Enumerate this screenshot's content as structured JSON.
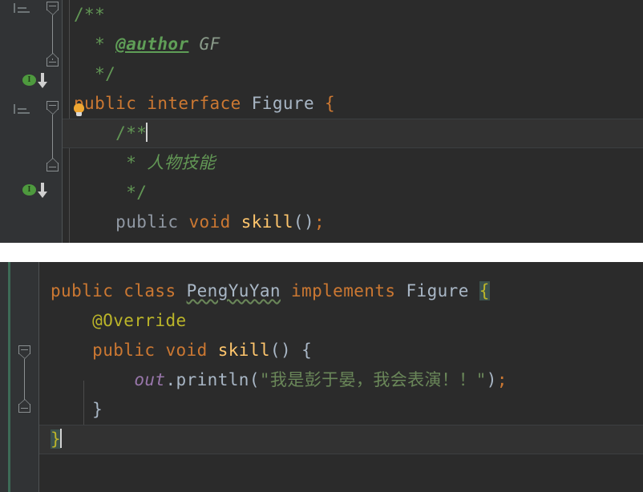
{
  "app": {
    "kind": "java-code-editor",
    "theme": "darcula",
    "colors": {
      "editor_background": "#2b2b2b",
      "gutter_background": "#313335",
      "page_background": "#ffffff",
      "keyword": "#cc7832",
      "keyword_dimmed": "#9199a4",
      "identifier": "#a9b7c6",
      "method": "#ffc66d",
      "annotation": "#bbb529",
      "javadoc": "#629755",
      "string": "#6a8759",
      "static_field": "#9876aa",
      "brace_match_highlight": "#3b514d",
      "vcs_modified_marker": "#3d6b57",
      "caret": "#d2d2d2"
    }
  },
  "panels": [
    {
      "name": "interface-figure-editor",
      "lines": [
        {
          "index": 0,
          "current": false,
          "gutter": [
            "doc-lines-icon",
            "fold-start-icon"
          ],
          "tokens": [
            {
              "cls": "cmt",
              "text": "/**"
            }
          ],
          "plain": "/**"
        },
        {
          "index": 1,
          "current": false,
          "gutter": [],
          "tokens": [
            {
              "cls": "cmt",
              "text": "  * "
            },
            {
              "cls": "cmt-tag",
              "text": "@author"
            },
            {
              "cls": "cmt-val",
              "text": " GF"
            }
          ],
          "plain": "  * @author GF"
        },
        {
          "index": 2,
          "current": false,
          "gutter": [
            "fold-end-icon"
          ],
          "tokens": [
            {
              "cls": "cmt",
              "text": "  */"
            }
          ],
          "plain": "  */"
        },
        {
          "index": 3,
          "current": false,
          "gutter": [
            "implemented-by-icon"
          ],
          "tokens": [
            {
              "cls": "kw",
              "text": "public interface "
            },
            {
              "cls": "type",
              "text": "Figure "
            },
            {
              "cls": "kw",
              "text": "{"
            }
          ],
          "plain": "public interface Figure {"
        },
        {
          "index": 4,
          "current": true,
          "gutter": [
            "doc-lines-icon",
            "fold-start-icon",
            "lightbulb-icon"
          ],
          "tokens": [
            {
              "cls": "cmt",
              "text": "    /**"
            }
          ],
          "plain": "    /**",
          "caret_after": true
        },
        {
          "index": 5,
          "current": false,
          "gutter": [],
          "tokens": [
            {
              "cls": "cmt",
              "text": "     * "
            },
            {
              "cls": "cmt-cjk",
              "text": "人物技能"
            }
          ],
          "plain": "     * 人物技能"
        },
        {
          "index": 6,
          "current": false,
          "gutter": [
            "fold-end-icon"
          ],
          "tokens": [
            {
              "cls": "cmt",
              "text": "     */"
            }
          ],
          "plain": "     */"
        },
        {
          "index": 7,
          "current": false,
          "gutter": [
            "implemented-by-icon"
          ],
          "tokens": [
            {
              "cls": "kw-dim",
              "text": "    public "
            },
            {
              "cls": "kw",
              "text": "void "
            },
            {
              "cls": "method",
              "text": "skill"
            },
            {
              "cls": "paren",
              "text": "()"
            },
            {
              "cls": "semi",
              "text": ";"
            }
          ],
          "plain": "    public void skill();"
        },
        {
          "index": 8,
          "current": false,
          "gutter": [],
          "tokens": [
            {
              "cls": "punct",
              "text": "}"
            }
          ],
          "plain": "}"
        }
      ]
    },
    {
      "name": "class-pengyuyan-editor",
      "lines": [
        {
          "index": 0,
          "current": false,
          "gutter": [],
          "tokens": [
            {
              "cls": "kw",
              "text": "public class "
            },
            {
              "cls": "typo",
              "text": "PengYuYan"
            },
            {
              "cls": "kw",
              "text": " implements "
            },
            {
              "cls": "type",
              "text": "Figure "
            },
            {
              "cls": "brace-hl",
              "text": "{"
            }
          ],
          "plain": "public class PengYuYan implements Figure {"
        },
        {
          "index": 1,
          "current": false,
          "gutter": [],
          "tokens": [
            {
              "cls": "anno",
              "text": "    @Override"
            }
          ],
          "plain": "    @Override"
        },
        {
          "index": 2,
          "current": false,
          "gutter": [
            "fold-start-icon"
          ],
          "tokens": [
            {
              "cls": "kw",
              "text": "    public void "
            },
            {
              "cls": "method",
              "text": "skill"
            },
            {
              "cls": "paren",
              "text": "() "
            },
            {
              "cls": "punct",
              "text": "{"
            }
          ],
          "plain": "    public void skill() {"
        },
        {
          "index": 3,
          "current": false,
          "gutter": [],
          "tokens": [
            {
              "cls": "static",
              "text": "        out"
            },
            {
              "cls": "punct",
              "text": ".println("
            },
            {
              "cls": "str",
              "text": "\""
            },
            {
              "cls": "str-cjk",
              "text": "我是彭于晏，我会表演！！"
            },
            {
              "cls": "str",
              "text": "\""
            },
            {
              "cls": "paren",
              "text": ")"
            },
            {
              "cls": "semi",
              "text": ";"
            }
          ],
          "plain": "        out.println(\"我是彭于晏，我会表演！！\");"
        },
        {
          "index": 4,
          "current": false,
          "gutter": [
            "fold-end-icon"
          ],
          "tokens": [
            {
              "cls": "punct",
              "text": "    }"
            }
          ],
          "plain": "    }"
        },
        {
          "index": 5,
          "current": true,
          "gutter": [],
          "tokens": [
            {
              "cls": "brace-hl",
              "text": "}"
            }
          ],
          "plain": "}",
          "caret_after": true
        },
        {
          "index": 6,
          "current": false,
          "gutter": [],
          "tokens": [],
          "plain": ""
        }
      ]
    }
  ]
}
